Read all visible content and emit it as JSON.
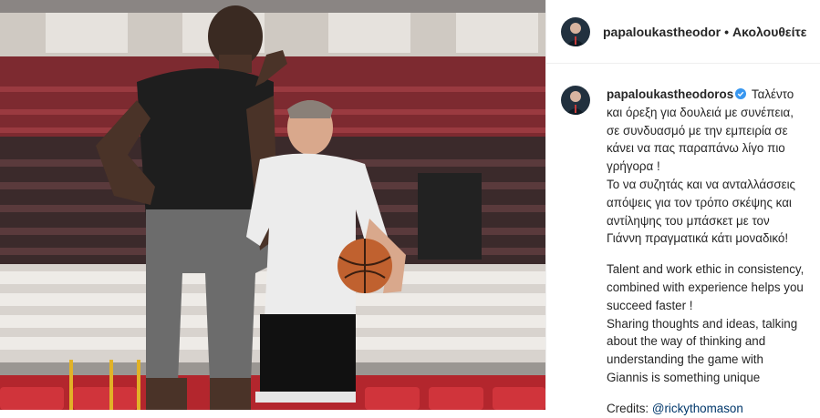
{
  "post": {
    "header_username": "papaloukastheodor",
    "separator": "•",
    "follow_status": "Ακολουθείτε"
  },
  "caption": {
    "username": "papaloukastheodoros",
    "greek_text": "Ταλέντο και όρεξη για δουλειά με συνέπεια, σε συνδυασμό με την εμπειρία σε κάνει να πας παραπάνω λίγο πιο γρήγορα !\nΤο να συζητάς και να ανταλλάσσεις απόψεις για τον τρόπο σκέψης και αντίληψης του μπάσκετ με τον Γιάννη πραγματικά κάτι μοναδικό!",
    "english_text": "Talent and work ethic in consistency, combined with experience helps you succeed faster !\nSharing thoughts and ideas, talking about the way of thinking and understanding the game with Giannis is something unique",
    "credits_label": "Credits:",
    "credits_mention": "@rickythomason"
  },
  "colors": {
    "verified_badge": "#3897f0",
    "mention": "#00376b",
    "seats_red": "#b3262d"
  }
}
